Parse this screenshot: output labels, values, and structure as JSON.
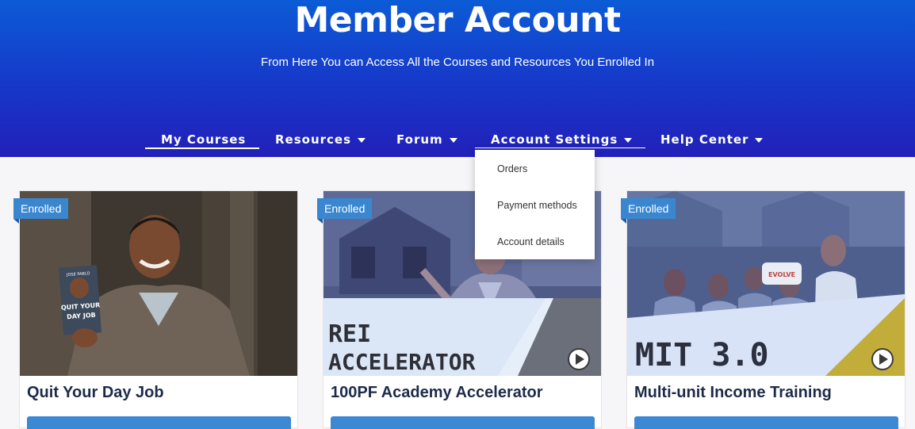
{
  "header": {
    "title": "Member Account",
    "subtitle": "From Here You can Access All the Courses and Resources You Enrolled In"
  },
  "nav": {
    "items": [
      {
        "label": "My Courses",
        "has_caret": false,
        "active": true
      },
      {
        "label": "Resources",
        "has_caret": true,
        "active": false
      },
      {
        "label": "Forum",
        "has_caret": true,
        "active": false
      },
      {
        "label": "Account Settings",
        "has_caret": true,
        "active": false,
        "expanded": true
      },
      {
        "label": "Help Center",
        "has_caret": true,
        "active": false
      }
    ]
  },
  "dropdown": {
    "items": [
      "Orders",
      "Payment methods",
      "Account details"
    ]
  },
  "courses": [
    {
      "badge": "Enrolled",
      "title": "Quit Your Day Job",
      "image_text": [
        "QUIT YOUR",
        "DAY JOB"
      ],
      "book_author": "JOSE PABLO"
    },
    {
      "badge": "Enrolled",
      "title": "100PF Academy Accelerator",
      "image_text": [
        "REI",
        "ACCELERATOR"
      ]
    },
    {
      "badge": "Enrolled",
      "title": "Multi-unit Income Training",
      "image_text": [
        "MIT 3.0"
      ],
      "sign_text": "EVOLVE"
    }
  ],
  "colors": {
    "hero_top": "#0c5bd6",
    "hero_bottom": "#2220b9",
    "badge": "#3a87d0",
    "button": "#3b88d4",
    "title_text": "#1d2b4a"
  }
}
